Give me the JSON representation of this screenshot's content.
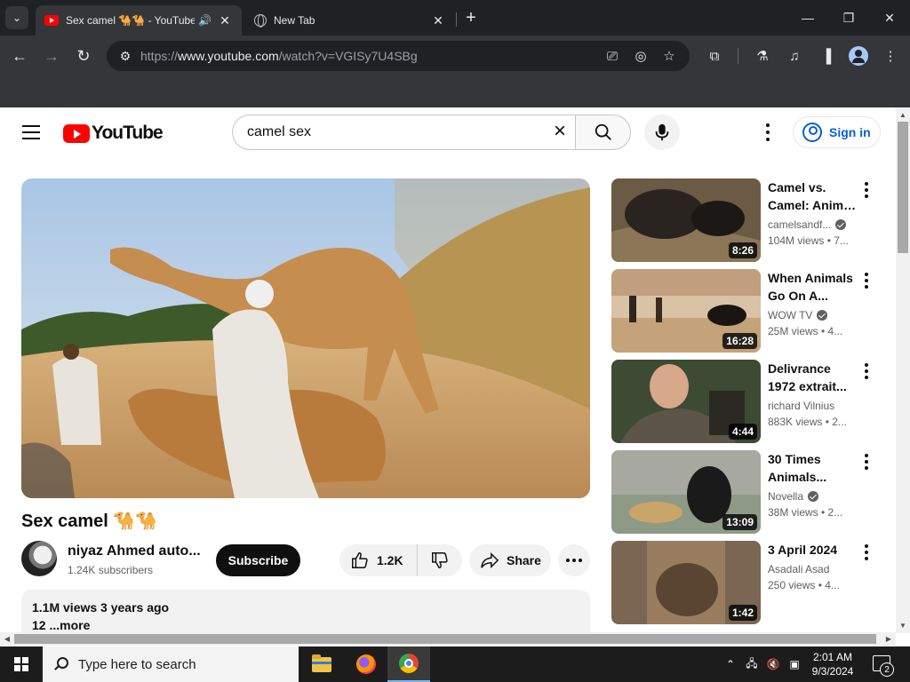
{
  "browser": {
    "tabs": [
      {
        "title": "Sex camel 🐪🐪 - YouTube"
      },
      {
        "title": "New Tab"
      }
    ],
    "url_prefix": "https://",
    "url_host": "www.youtube.com",
    "url_path": "/watch?v=VGISy7U4SBg",
    "icons": [
      "tab-search-icon",
      "youtube-favicon",
      "speaker-icon",
      "close-icon",
      "globe-icon",
      "plus-icon",
      "minimize-icon",
      "maximize-icon",
      "close-window-icon",
      "back-icon",
      "forward-icon",
      "reload-icon",
      "site-info-icon",
      "cast-icon",
      "eye-off-icon",
      "star-icon",
      "extensions-icon",
      "lab-icon",
      "media-icon",
      "side-panel-icon",
      "profile-icon",
      "more-vert-icon"
    ],
    "window_controls": {
      "minimize": "—",
      "maximize": "❐",
      "close": "✕"
    }
  },
  "header": {
    "logo_text": "YouTube",
    "search_value": "camel sex",
    "sign_in_label": "Sign in"
  },
  "video": {
    "title": "Sex camel 🐪🐪",
    "channel_name": "niyaz Ahmed auto...",
    "subscribers": "1.24K subscribers",
    "subscribe_label": "Subscribe",
    "likes": "1.2K",
    "share_label": "Share",
    "views_line": "1.1M views  3 years ago",
    "desc_line": "12 ...more"
  },
  "recommendations": [
    {
      "title_1": "Camel vs.",
      "title_2": "Camel: Anima...",
      "channel": "camelsandf...",
      "verified": true,
      "meta": "104M views • 7...",
      "duration": "8:26"
    },
    {
      "title_1": "When Animals",
      "title_2": "Go On A...",
      "channel": "WOW TV",
      "verified": true,
      "meta": "25M views • 4...",
      "duration": "16:28"
    },
    {
      "title_1": "Delivrance",
      "title_2": "1972 extrait...",
      "channel": "richard Vilnius",
      "verified": false,
      "meta": "883K views • 2...",
      "duration": "4:44"
    },
    {
      "title_1": "30 Times",
      "title_2": "Animals...",
      "channel": "Novella",
      "verified": true,
      "meta": "38M views • 2...",
      "duration": "13:09"
    },
    {
      "title_1": "3 April 2024",
      "title_2": "",
      "channel": "Asadali Asad",
      "verified": false,
      "meta": "250 views • 4...",
      "duration": "1:42"
    }
  ],
  "taskbar": {
    "search_placeholder": "Type here to search",
    "time": "2:01 AM",
    "date": "9/3/2024",
    "notification_count": "2"
  },
  "colors": {
    "youtube_red": "#ff0000",
    "link_blue": "#065fd4",
    "chrome_dark": "#202124"
  }
}
